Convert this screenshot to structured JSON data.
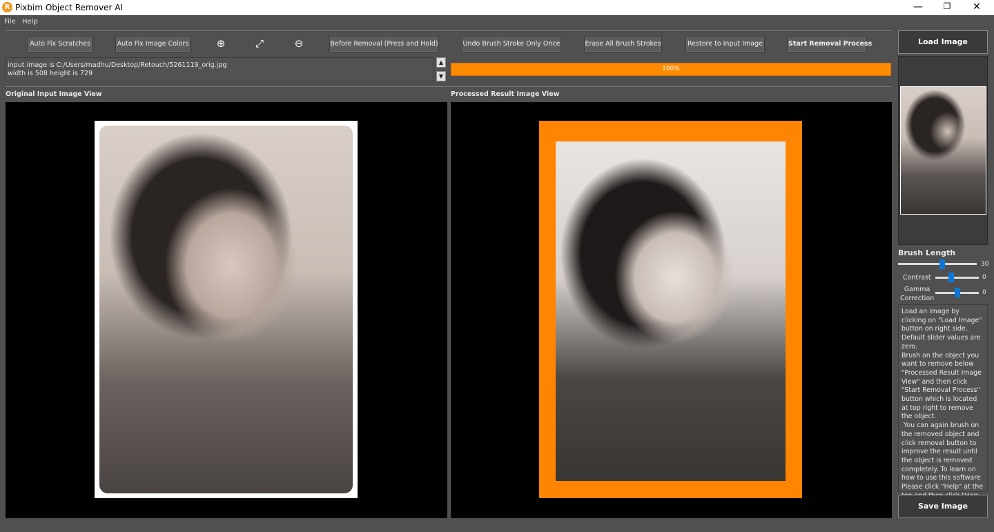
{
  "window": {
    "title": "Pixbim Object Remover AI",
    "logo_letter": "R",
    "minimize": "—",
    "restore": "❐",
    "close": "✕"
  },
  "menu": {
    "items": [
      "File",
      "Help"
    ]
  },
  "toolbar": {
    "auto_fix_scratches": "Auto Fix Scratches",
    "auto_fix_colors": "Auto Fix Image Colors",
    "zoom_in_icon": "zoom-in",
    "fit_icon": "expand",
    "zoom_out_icon": "zoom-out",
    "before_removal": "Before Removal (Press and Hold)",
    "undo_stroke": "Undo Brush Stroke Only Once",
    "erase_strokes": "Erase All Brush Strokes",
    "restore_input": "Restore to Input Image",
    "start_removal": "Start Removal Process"
  },
  "info": {
    "line1": "input image is C:/Users/madhu/Desktop/Retouch/5261119_orig.jpg",
    "line2": "width is 508 height is 729"
  },
  "progress": {
    "value": 100,
    "label": "100%",
    "color": "#ff8c00"
  },
  "views": {
    "original_label": "Original Input Image View",
    "processed_label": "Processed Result Image View"
  },
  "right_panel": {
    "load_image": "Load Image",
    "save_image": "Save Image",
    "brush_length_label": "Brush Length",
    "brush_length_value": "30",
    "contrast_label": "Contrast",
    "contrast_value": "0",
    "gamma_label": "Gamma\nCorrection",
    "gamma_value": "0",
    "help_text": "Load an image by clicking on \"Load Image\" button on right side. Default slider values are zero.\nBrush on the object you want to remove below \"Processed Result Image View\" and then click \"Start Removal Process\" button which is located at top right to remove the object.\n You can again brush on the removed object and click removal button to improve the result until the object is removed completely. To learn on how to use this software Please click \"Help\" at the top and then click \"How to Use the Software\"\npixbim.com"
  }
}
